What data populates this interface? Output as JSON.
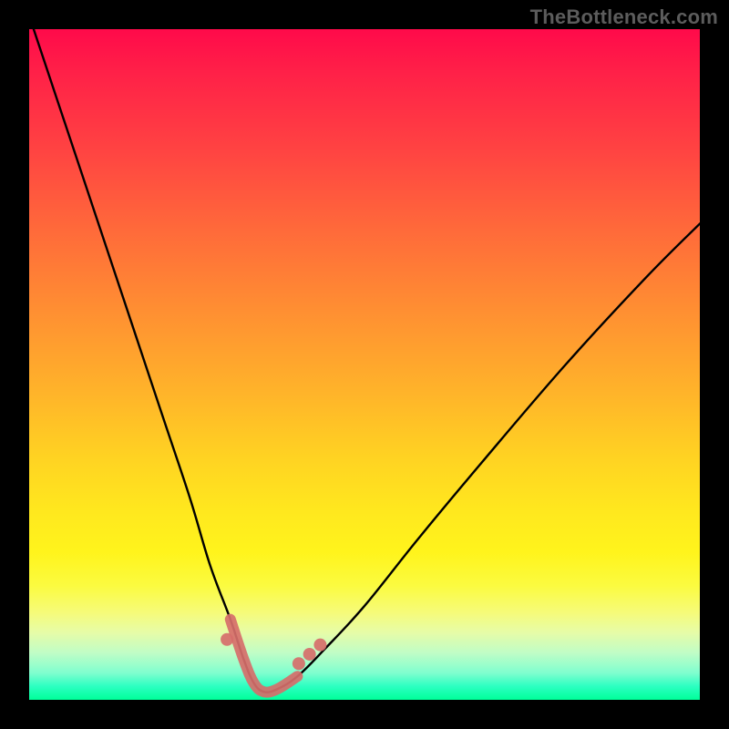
{
  "watermark": "TheBottleneck.com",
  "colors": {
    "accent_marker": "#d66e6a",
    "curve_stroke": "#000000",
    "frame_bg": "#000000"
  },
  "chart_data": {
    "type": "line",
    "title": "",
    "xlabel": "",
    "ylabel": "",
    "xlim": [
      0,
      100
    ],
    "ylim": [
      0,
      100
    ],
    "grid": false,
    "legend": false,
    "series": [
      {
        "name": "bottleneck-curve",
        "x": [
          0,
          4,
          8,
          12,
          16,
          20,
          24,
          27,
          30,
          32,
          33.5,
          35,
          37,
          40,
          44,
          50,
          58,
          68,
          80,
          92,
          100
        ],
        "y": [
          102,
          90,
          78,
          66,
          54,
          42,
          30,
          20,
          12,
          6,
          2.5,
          1.2,
          1.6,
          3.5,
          7.5,
          14,
          24,
          36,
          50,
          63,
          71
        ]
      }
    ],
    "markers": [
      {
        "name": "trough-segment",
        "x_range": [
          31,
          39
        ],
        "style": "thick-stroke"
      },
      {
        "name": "dot",
        "x": 29.5,
        "y": 9
      },
      {
        "name": "dot",
        "x": 40.2,
        "y": 5.4
      },
      {
        "name": "dot",
        "x": 41.8,
        "y": 6.8
      },
      {
        "name": "dot",
        "x": 43.4,
        "y": 8.2
      }
    ]
  }
}
